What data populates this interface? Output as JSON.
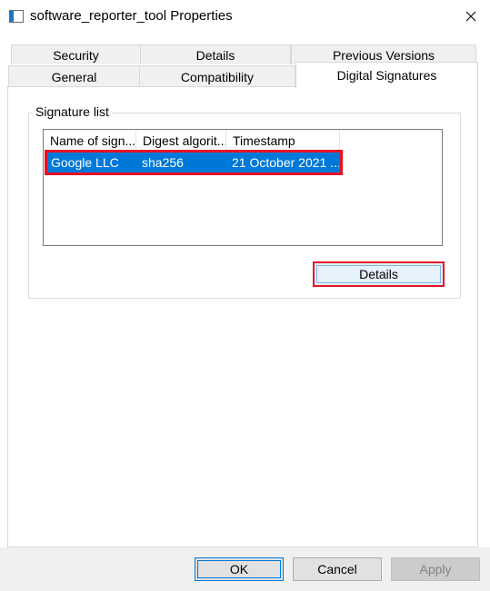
{
  "window": {
    "title": "software_reporter_tool Properties",
    "accent_color": "#0078d7",
    "highlight_color": "#e81123"
  },
  "tabs": {
    "row_back": [
      {
        "label": "Security"
      },
      {
        "label": "Details"
      },
      {
        "label": "Previous Versions"
      }
    ],
    "row_front": [
      {
        "label": "General"
      },
      {
        "label": "Compatibility"
      },
      {
        "label": "Digital Signatures",
        "selected": true
      }
    ]
  },
  "signature_list": {
    "group_label": "Signature list",
    "columns": [
      "Name of sign...",
      "Digest algorit...",
      "Timestamp"
    ],
    "rows": [
      {
        "name": "Google LLC",
        "digest": "sha256",
        "timestamp": "21 October 2021 ...",
        "selected": true
      }
    ],
    "details_label": "Details"
  },
  "footer": {
    "ok_label": "OK",
    "cancel_label": "Cancel",
    "apply_label": "Apply",
    "apply_disabled": true
  }
}
